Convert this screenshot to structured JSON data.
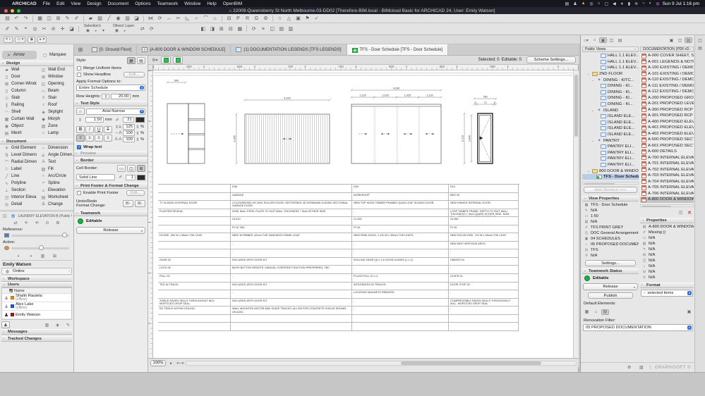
{
  "menubar": {
    "items": [
      "ARCHICAD",
      "File",
      "Edit",
      "View",
      "Design",
      "Document",
      "Options",
      "Teamwork",
      "Window",
      "Help",
      "OpenBIM"
    ],
    "status_icons": [
      {
        "n": "keyboard-icon",
        "g": "▤"
      },
      {
        "n": "shield-icon",
        "g": "♟"
      },
      {
        "n": "warning-icon",
        "g": "▲",
        "c": "#f0b429"
      },
      {
        "n": "record-icon",
        "g": "◎"
      },
      {
        "n": "home-icon",
        "g": "⌂"
      },
      {
        "n": "display-icon",
        "g": "▢"
      },
      {
        "n": "volume-icon",
        "g": "◀"
      },
      {
        "n": "bluetooth-icon",
        "g": "∗"
      },
      {
        "n": "battery-icon",
        "g": "▮"
      },
      {
        "n": "wifi-icon",
        "g": "≋"
      },
      {
        "n": "spotlight-icon",
        "g": "○"
      },
      {
        "n": "control-center-icon",
        "g": "◐"
      },
      {
        "n": "siri-icon",
        "g": "◍",
        "c": "#c06cd8"
      }
    ],
    "clock": "Sun 9 Jul 1:16 pm"
  },
  "titlebar": {
    "title": "⌂ 22009-Queensberry St North Melbourne-03-DD02 [Therefore-BIM.local - BIMcloud Basic for ARCHICAD 24, User: Emily Watson]"
  },
  "toolbar1": [
    {
      "n": "save-icon",
      "g": "▤"
    },
    {
      "n": "undo-icon",
      "g": "↶"
    },
    {
      "n": "redo-icon",
      "g": "↷"
    },
    {
      "sep": 1
    },
    {
      "n": "stories-icon",
      "g": "▦"
    },
    {
      "n": "layers-icon",
      "g": "◫"
    },
    {
      "n": "grid-snap-icon",
      "g": "⊞"
    },
    {
      "n": "pen-icon",
      "g": "✎"
    },
    {
      "n": "pen-color-icon",
      "g": "✐"
    },
    {
      "sep": 1
    },
    {
      "n": "wall-default-icon",
      "g": "▰"
    },
    {
      "n": "fill-default-icon",
      "g": "▨"
    },
    {
      "n": "line-default-icon",
      "g": "╱"
    },
    {
      "n": "marker-default-icon",
      "g": "◉"
    },
    {
      "n": "composite-icon",
      "g": "▥"
    },
    {
      "n": "profile-icon",
      "g": "◪"
    },
    {
      "sep": 1
    },
    {
      "n": "mirror-icon",
      "g": "⋈"
    },
    {
      "n": "rotate-icon",
      "g": "⟳"
    },
    {
      "n": "stretch-icon",
      "g": "↔"
    },
    {
      "n": "trim-icon",
      "g": "✂"
    },
    {
      "n": "split-icon",
      "g": "◺"
    },
    {
      "n": "adjust-icon",
      "g": "⌐"
    },
    {
      "n": "fillet-icon",
      "g": "⌒"
    },
    {
      "n": "home-icon",
      "g": "⌂"
    },
    {
      "sep": 1
    },
    {
      "n": "grid-options-icon",
      "g": "⊟"
    },
    {
      "n": "pin-icon",
      "g": "P"
    },
    {
      "n": "renovation-icon",
      "g": "R"
    },
    {
      "n": "override-icon",
      "g": "G"
    },
    {
      "n": "settings-dropdown-icon",
      "g": "⚙"
    },
    {
      "sep": 1
    },
    {
      "n": "favorites-icon",
      "g": "☆"
    },
    {
      "n": "publish-icon",
      "g": "△"
    },
    {
      "n": "library-icon",
      "g": "▣"
    },
    {
      "n": "tag-icon",
      "g": "⚑"
    },
    {
      "n": "check-icon",
      "g": "✓"
    }
  ],
  "toolbar2": {
    "tools": [
      {
        "n": "pickup-parameters-icon",
        "g": "✐"
      },
      {
        "n": "inject-parameters-icon",
        "g": "✎"
      },
      {
        "n": "measure-icon",
        "g": "⌖"
      },
      {
        "n": "find-select-icon",
        "g": "◎"
      },
      {
        "n": "cut-icon",
        "g": "✂"
      },
      {
        "n": "suspend-groups-icon",
        "g": "⊘"
      },
      {
        "n": "explode-icon",
        "g": "✛"
      },
      {
        "n": "solid-ops-icon",
        "g": "◪"
      }
    ],
    "selections_label": "Selection's",
    "sel_icons": [
      {
        "n": "show-selection-icon",
        "g": "◉"
      },
      {
        "n": "lock-selection-icon",
        "g": "◒"
      },
      {
        "n": "selection-more-icon",
        "g": "▾"
      }
    ],
    "others_label": "Others' Layer:",
    "oth_icons": [
      {
        "n": "show-others-icon",
        "g": "◉"
      },
      {
        "n": "lock-others-icon",
        "g": "◒"
      }
    ],
    "mid_icons": [
      {
        "n": "quick-layers-icon",
        "g": "⇄"
      },
      {
        "n": "layer-refresh-icon",
        "g": "⟳"
      }
    ],
    "right_icons": [
      {
        "n": "reno-existing-icon",
        "g": "◧"
      },
      {
        "n": "reno-demo-icon",
        "g": "◨"
      },
      {
        "n": "reno-new-icon",
        "g": "⊞"
      },
      {
        "n": "reno-plan-icon",
        "g": "⊟"
      },
      {
        "n": "reno-filter-icon",
        "g": "▦"
      },
      {
        "sep": 1
      },
      {
        "n": "update-icon",
        "g": "⟳"
      },
      {
        "n": "list-icon",
        "g": "≡"
      },
      {
        "n": "palette-icon",
        "g": "◫"
      },
      {
        "n": "report-icon",
        "g": "▤"
      },
      {
        "n": "print-setup-icon",
        "g": "▥"
      }
    ]
  },
  "quickbar": [
    {
      "n": "layer-shortcut",
      "g": "⌗ ▾"
    },
    {
      "n": "scale-shortcut",
      "g": "▭ ▾"
    },
    {
      "n": "wand-icon",
      "g": "◉"
    },
    {
      "n": "arrow-mode-button",
      "g": "▸ ▾"
    }
  ],
  "tabs": [
    {
      "label": "[0. Ground Floor]",
      "icon": "folder",
      "active": false
    },
    {
      "label": "[A-800 DOOR & WINDOW SCHEDULE]",
      "icon": "schedule",
      "active": false
    },
    {
      "label": "(1) DOCUMENTATION LEGENDS [TFS LEGENDS]",
      "icon": "worksheet",
      "active": false
    },
    {
      "label": "TFS - Door Schedule [TFS - Door Schedule]",
      "icon": "schedule-green",
      "active": true
    }
  ],
  "toolbox": {
    "arrow": "Arrow",
    "marquee": "Marquee",
    "design_header": "Design",
    "document_header": "Document",
    "design_tools": [
      [
        "Wall",
        "▰"
      ],
      [
        "Wall End",
        "◫"
      ],
      [
        "Door",
        "▯"
      ],
      [
        "Window",
        "⊞"
      ],
      [
        "Corner-Window",
        "⊠"
      ],
      [
        "Opening",
        "◱"
      ],
      [
        "Column",
        "▯"
      ],
      [
        "Beam",
        "▭"
      ],
      [
        "Slab",
        "◇"
      ],
      [
        "Stair",
        "≡"
      ],
      [
        "Railing",
        "∥"
      ],
      [
        "Roof",
        "⌂"
      ],
      [
        "Shell",
        "◠"
      ],
      [
        "Skylight",
        "◈"
      ],
      [
        "Curtain Wall",
        "▦"
      ],
      [
        "Morph",
        "◆"
      ],
      [
        "Object",
        "◉"
      ],
      [
        "Zone",
        "▨"
      ],
      [
        "Mesh",
        "▤"
      ],
      [
        "Lamp",
        "☼"
      ]
    ],
    "document_tools": [
      [
        "Grid Element",
        "✛"
      ],
      [
        "Dimension",
        "↔"
      ],
      [
        "Level Dimens...",
        "⇅"
      ],
      [
        "Angle Dimen...",
        "∠"
      ],
      [
        "Radial Dimen...",
        "⌒"
      ],
      [
        "Text",
        "A"
      ],
      [
        "Label",
        "⚐"
      ],
      [
        "Fill",
        "▨"
      ],
      [
        "Line",
        "╱"
      ],
      [
        "Arc/Circle",
        "○"
      ],
      [
        "Polyline",
        "∿"
      ],
      [
        "Spline",
        "≈"
      ],
      [
        "Section",
        "⊥"
      ],
      [
        "Elevation",
        "⌅"
      ],
      [
        "Interior Eleva...",
        "◳"
      ],
      [
        "Worksheet",
        "▤"
      ],
      [
        "Detail",
        "◎"
      ],
      [
        "Change",
        "Δ"
      ]
    ]
  },
  "infobox": {
    "style_label": "Style:",
    "merge": "Merge Uniform Items",
    "headline": "Show Headline",
    "edit": "Edit...",
    "apply_label": "Apply Format Options to:",
    "apply_value": "Entire Schedule",
    "row_heights_label": "Row Heights:",
    "row_height": "20.00",
    "mm": "mm",
    "text_style_header": "Text Style",
    "font": "Arial Narrow",
    "font_size": "1.50",
    "pen": "21",
    "sp1": "125",
    "sp2": "100",
    "sp3": "100",
    "pct": "%",
    "b": "B",
    "i": "I",
    "u": "U",
    "t": "T",
    "wrap": "Wrap text",
    "preview": "Preview",
    "border_header": "Border",
    "cell_border": "Cell Border:",
    "line_type": "Solid Line",
    "border_pen": "1",
    "pf_header": "Print Footer & Format Change",
    "enable_footer": "Enable Print Footer",
    "undo1": "Undo/Redo",
    "undo2": "Format Change:",
    "undo_btn": "B/-",
    "teamwork_header": "Teamwork",
    "editable": "Editable",
    "release": "Release"
  },
  "trace": {
    "view": "LAUNDRY ELEVATION B (Public Vie...",
    "reference_label": "Reference:",
    "active_label": "Active:",
    "icons": [
      {
        "n": "trace-switch-icon",
        "g": "⇄"
      },
      {
        "n": "drag-reference-icon",
        "g": "✛"
      },
      {
        "n": "rotate-reference-icon",
        "g": "⟲"
      },
      {
        "n": "reset-reference-icon",
        "g": "⊙"
      },
      {
        "n": "trace-settings-icon",
        "g": "⚙"
      }
    ],
    "toggles": [
      {
        "n": "fill-toggle-icon",
        "g": "◐"
      },
      {
        "n": "contrast-toggle-icon",
        "g": "◑"
      },
      {
        "n": "split-view-icon",
        "g": "▥"
      },
      {
        "n": "grid-toggle-icon",
        "g": "⊞"
      }
    ]
  },
  "teamwork": {
    "user": "Emily Watson",
    "status": "Online",
    "workspace": "Workspace",
    "users_header": "Users",
    "name_col": "Name",
    "users": [
      {
        "name": "Shalin Rautela",
        "sub": "(offline)",
        "color": "#f08c1e",
        "offline": true
      },
      {
        "name": "Alex Lake",
        "sub": "(offline)",
        "color": "#2457e0",
        "offline": true
      },
      {
        "name": "Emily Watson",
        "sub": "",
        "color": "#b01020",
        "offline": false
      }
    ],
    "footer_icons": [
      {
        "n": "add-user-icon",
        "g": "♟"
      },
      {
        "n": "message-icon",
        "g": "▥"
      },
      {
        "n": "colors-icon",
        "g": "◈"
      },
      {
        "n": "assign-icon",
        "g": "✎"
      }
    ],
    "messages": "Messages",
    "tracked": "Tracked Changes"
  },
  "canvas": {
    "selected": "Selected: 0",
    "editable": "Editable: 0",
    "scheme_button": "Scheme Settings...",
    "zoom": "100%",
    "ruler_labels": [
      "600",
      "650",
      "700",
      "750",
      "800",
      "850",
      "900"
    ]
  },
  "drawings": {
    "door1": {
      "width_dim": "900"
    },
    "roller": {
      "width_dim": "4,100",
      "height_dim": "2,335"
    },
    "quad": {
      "width_dim": "4,290",
      "sub_dims": [
        "1,120",
        "1,025",
        "1,025",
        "1,120"
      ]
    },
    "hinged": {
      "width_dim": "750",
      "sub_dims": [
        "20",
        "710",
        "20"
      ],
      "height_dims": [
        "2,110",
        "2,040"
      ]
    }
  },
  "schedule": {
    "rows": [
      [
        "",
        "D08",
        "D09",
        "D10"
      ],
      [
        "",
        "GARAGE",
        "WORKSHOP",
        "BED 03"
      ],
      [
        "TY SLIDING INTERNAL DOOR.",
        "COLOURBOND OR ZINC ROLLER DOOR / MOTORISED 4D HORMANN SLIDING SECTIONAL GARAGE DOOR.",
        "NEW TOP HUNG TIMBER FRAMED QUAD LEAF SLIDING DOOR.",
        "NEW HINGED INTERNAL DOOR."
      ],
      [
        "PLASTER REVEAL.",
        "NOM. 8mm STEEL PLATE TO SUIT WALL THICKNESS + 5mm EITHER SIDE.",
        "-",
        "LOSP TIMBER FRAME, DEPTH TO SUIT WALL THICKNESS + 5mm QUIRK EITHER SIDE. NOM. 10mm STOP TO 3 SIDES OF FRAME."
      ],
      [
        "",
        "22.510",
        "21.430",
        "24.980"
      ],
      [
        "",
        "PY10 TBC.",
        "PY10.",
        "PY10."
      ],
      [
        "DCORE, 900 W x 35mm THK LEAF.",
        "NEW 'W RIBBED' 42mm THK SANDWICH PANEL LEAF.",
        "NEW SEMI-SOLID, 1,100 W x 35mm THK LEAFS.",
        "NEW SOLIDCORE, 720 W x 35mm THK LEAF."
      ],
      [
        "",
        "-",
        "-",
        "NEW MDF HERITAGE ARCS."
      ],
      [
        "",
        "-",
        "-",
        "-"
      ],
      [
        "GEAR 02",
        "INCLUDED WITH DOOR KIT.",
        "ROLLING GEAR (3) x 2 & DOOR GUIDES (1 x 2).",
        "HINGES 02."
      ],
      [
        "LOCK 08",
        "BUSH BUTTON REMOTE, MANUAL OVERRIDE FUNCTION PREFERRED, TBC.",
        "-",
        "-"
      ],
      [
        "PULL 02",
        "-",
        "FLUSH PULL 01 x 4.",
        "LEVER 01."
      ],
      [
        "TED IN TRACK.",
        "INCLUDED WITH DOOR KIT.",
        "INTEGRATED IN TRACKS.",
        "DOOR STOP 02."
      ],
      [
        "",
        "-",
        "LOCATING MAGNETS REBATED.",
        "-"
      ],
      [
        "SSIBLE RAVEN SEALS THROUGHOUT INCL. MORTICED DROP SEAL.",
        "INCLUDED WITH DOOR KIT.",
        "-",
        "COMPRESSIBLE RAVEN SEALS THROUGHOUT INCL. MORTICED DROP SEAL."
      ],
      [
        "ED TRACK WITHIN CEILING.",
        "WALL MOUNTED MOTOR AND GUIDE TRACKS. ALLOW FOR CONCRETE HOB AS SHOWN ON A200.",
        "-",
        "-"
      ]
    ]
  },
  "navigator": {
    "viewmap_header": "Public Views",
    "tree": [
      {
        "l": "HALL 1.1 ELEV...",
        "ic": "view",
        "lv": 3
      },
      {
        "l": "HALL 1.1 ELEV...",
        "ic": "view",
        "lv": 3
      },
      {
        "l": "HALL 1.1 ELEV...",
        "ic": "view",
        "lv": 3
      },
      {
        "l": "2ND FLOOR",
        "ic": "folder",
        "lv": 1,
        "ex": true
      },
      {
        "l": "DINING - KITC...",
        "ic": "group",
        "lv": 2,
        "ex": true
      },
      {
        "l": "DINING - KI...",
        "ic": "view",
        "lv": 3
      },
      {
        "l": "DINING - KI...",
        "ic": "view",
        "lv": 3
      },
      {
        "l": "DINING - KI...",
        "ic": "view",
        "lv": 3
      },
      {
        "l": "DINING - KI...",
        "ic": "view",
        "lv": 3
      },
      {
        "l": "ISLAND",
        "ic": "group",
        "lv": 2,
        "ex": true
      },
      {
        "l": "ISLAND ELE...",
        "ic": "view",
        "lv": 3
      },
      {
        "l": "ISLAND ELE...",
        "ic": "view",
        "lv": 3
      },
      {
        "l": "ISLAND ELE...",
        "ic": "view",
        "lv": 3
      },
      {
        "l": "ISLAND ELE...",
        "ic": "view",
        "lv": 3
      },
      {
        "l": "PANTRY",
        "ic": "group",
        "lv": 2,
        "ex": true
      },
      {
        "l": "PANTRY ELI...",
        "ic": "view",
        "lv": 3
      },
      {
        "l": "PANTRY ELI...",
        "ic": "view",
        "lv": 3
      },
      {
        "l": "PANTRY ELI...",
        "ic": "view",
        "lv": 3
      },
      {
        "l": "PANTRY ELI...",
        "ic": "view",
        "lv": 3
      },
      {
        "l": "800 DOOR & WINDOW",
        "ic": "folder",
        "lv": 1,
        "ex": true
      },
      {
        "l": "TFS - Door Schedu...",
        "ic": "sched",
        "lv": 2,
        "sel": true
      }
    ],
    "add_shortcut": "Add Shortcut >>>",
    "view_properties_header": "View Properties",
    "view_properties": [
      {
        "g": "▦",
        "t": "TFS - Door Schedule"
      },
      {
        "g": "✎",
        "t": "N/A"
      },
      {
        "g": "▭",
        "t": "1:50"
      },
      {
        "g": "▤",
        "t": "N/A"
      },
      {
        "g": "✐",
        "t": "TFS PRINT GREY"
      },
      {
        "g": "◫",
        "t": "DOC General Arrangement"
      },
      {
        "g": "▣",
        "t": "04 SCHEDULES"
      },
      {
        "g": "⌂",
        "t": "05 PROPOSED DOCUMENTATION"
      },
      {
        "g": "⊟",
        "t": "TFS"
      },
      {
        "g": "⚲",
        "t": "N/A"
      }
    ],
    "settings_button": "Settings...",
    "teamwork_status_header": "Teamwork Status",
    "editable_label": "Editable",
    "release_label": "Release",
    "publish_label": "Publish",
    "layouts_header": "DOCUMENTATION (PDF+D...",
    "layouts": [
      "A-000 COVER SHEET, SIT...",
      "A-001 LEGENDS & NOTE...",
      "A-100 EXISTING / DEMOL...",
      "A-101 EXISTING / DEMOL...",
      "A-110 EXISTING / DEMOL...",
      "A-111 EXISTING / DEMOL...",
      "A-112 EXISTING / DEMOL...",
      "A-200 PROPOSED GROU...",
      "A-201 PROPOSED LEVEL...",
      "A-300 PROPOSED RCP G...",
      "A-301 PROPOSED RCP LI...",
      "A-400 PROPOSED ELEVA...",
      "A-401 PROPOSED ELEVA...",
      "A-402 PROPOSED ELEVA...",
      "A-500 PROPOSED SECTI...",
      "A-501 PROPOSED SECTI...",
      "A-600 DETAILS",
      "A-700 INTERNAL ELEVAT...",
      "A-701 INTERNAL ELEVAT...",
      "A-702 INTERNAL ELEVAT...",
      "A-703 INTERNAL ELEVAT...",
      "A-704 INTERNAL ELEVAT...",
      "A-705 INTERNAL ELEVAT...",
      "A-706 INTERNAL ELEVAT...",
      "A-800 DOOR & WINDOW"
    ],
    "selected_layout_index": 24,
    "properties_header": "Properties",
    "properties": [
      {
        "g": "▤",
        "t": "A-800 DOOR & WINDOW SCHE..."
      },
      {
        "g": "✐",
        "t": "Missing ()"
      },
      {
        "g": "▭",
        "t": "N/A"
      },
      {
        "g": "▤",
        "t": "N/A"
      },
      {
        "g": "✎",
        "t": "N/A"
      },
      {
        "g": "⊞",
        "t": "N/A"
      },
      {
        "g": "◫",
        "t": "N/A"
      },
      {
        "g": "⌂",
        "t": "N/A"
      },
      {
        "g": "⊟",
        "t": "N/A"
      },
      {
        "g": "⚲",
        "t": "N/A"
      }
    ],
    "format_header": "Format",
    "format_selector": "selected items",
    "default_elements_label": "Default Elements:",
    "renovation_filter_label": "Renovation Filter:",
    "renovation_filter_value": "05 PROPOSED DOCUMENTATION",
    "brand": "GRAPHISOFT ©"
  },
  "colors": {
    "accent_blue": "#3272e0",
    "editable_green": "#1fae46",
    "selection_red": "#e03030",
    "tab_green": "#2ebf4f"
  }
}
